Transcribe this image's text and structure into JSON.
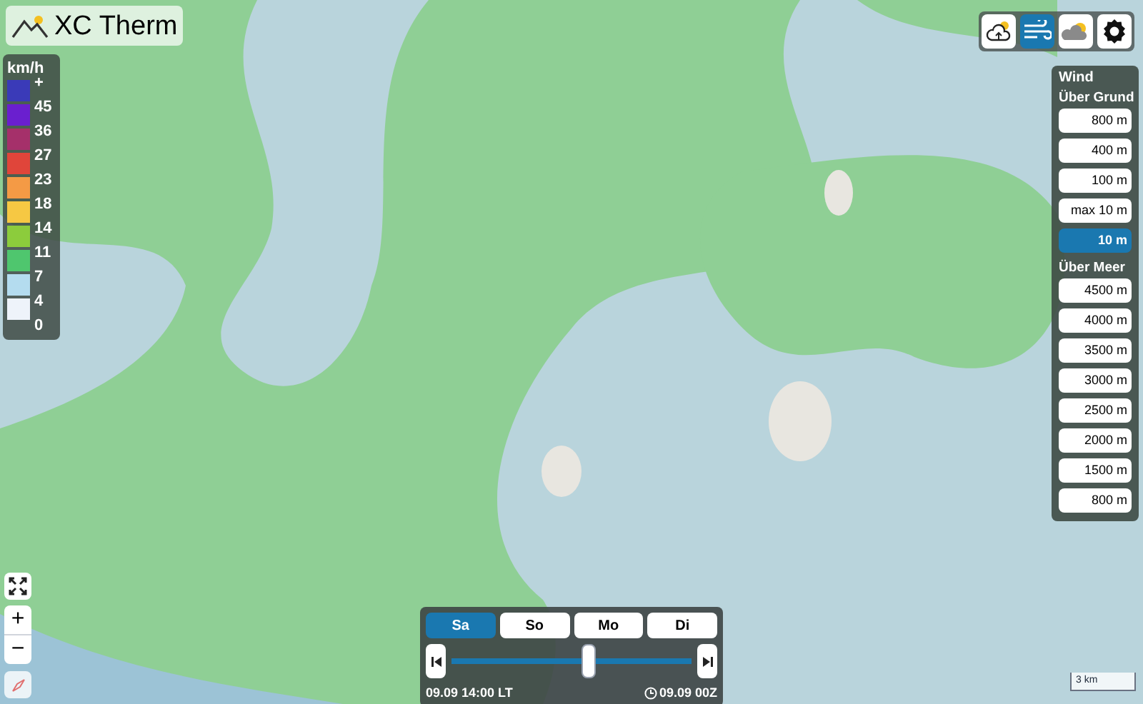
{
  "app": {
    "title": "XC Therm"
  },
  "legend": {
    "unit": "km/h",
    "bands": [
      {
        "label": "+",
        "color": "#3a3ab8"
      },
      {
        "label": "45",
        "color": "#6a1fcf"
      },
      {
        "label": "36",
        "color": "#a5306a"
      },
      {
        "label": "27",
        "color": "#e0453a"
      },
      {
        "label": "23",
        "color": "#f49a45"
      },
      {
        "label": "18",
        "color": "#f6c843"
      },
      {
        "label": "14",
        "color": "#8ccc3c"
      },
      {
        "label": "11",
        "color": "#4fc66e"
      },
      {
        "label": "7",
        "color": "#b4dcef"
      },
      {
        "label": "4",
        "color": "#eef3fa"
      }
    ],
    "bottom_label": "0"
  },
  "layer_buttons": [
    {
      "kind": "thermal",
      "selected": false
    },
    {
      "kind": "wind",
      "selected": true
    },
    {
      "kind": "clouds",
      "selected": false
    },
    {
      "kind": "settings",
      "selected": false
    }
  ],
  "wind_panel": {
    "title": "Wind",
    "sections": [
      {
        "heading": "Über Grund",
        "levels": [
          {
            "label": "800 m",
            "selected": false
          },
          {
            "label": "400 m",
            "selected": false
          },
          {
            "label": "100 m",
            "selected": false
          },
          {
            "label": "max 10 m",
            "selected": false
          },
          {
            "label": "10 m",
            "selected": true
          }
        ]
      },
      {
        "heading": "Über Meer",
        "levels": [
          {
            "label": "4500 m",
            "selected": false
          },
          {
            "label": "4000 m",
            "selected": false
          },
          {
            "label": "3500 m",
            "selected": false
          },
          {
            "label": "3000 m",
            "selected": false
          },
          {
            "label": "2500 m",
            "selected": false
          },
          {
            "label": "2000 m",
            "selected": false
          },
          {
            "label": "1500 m",
            "selected": false
          },
          {
            "label": "800 m",
            "selected": false
          }
        ]
      }
    ]
  },
  "days": [
    {
      "label": "Sa",
      "selected": true
    },
    {
      "label": "So",
      "selected": false
    },
    {
      "label": "Mo",
      "selected": false
    },
    {
      "label": "Di",
      "selected": false
    }
  ],
  "timeline": {
    "level": 0.57,
    "local_time": "09.09 14:00 LT",
    "model_run": "09.09 00Z"
  },
  "map_controls": {
    "zoom_in": "+",
    "zoom_out": "−"
  },
  "scale": "3 km"
}
